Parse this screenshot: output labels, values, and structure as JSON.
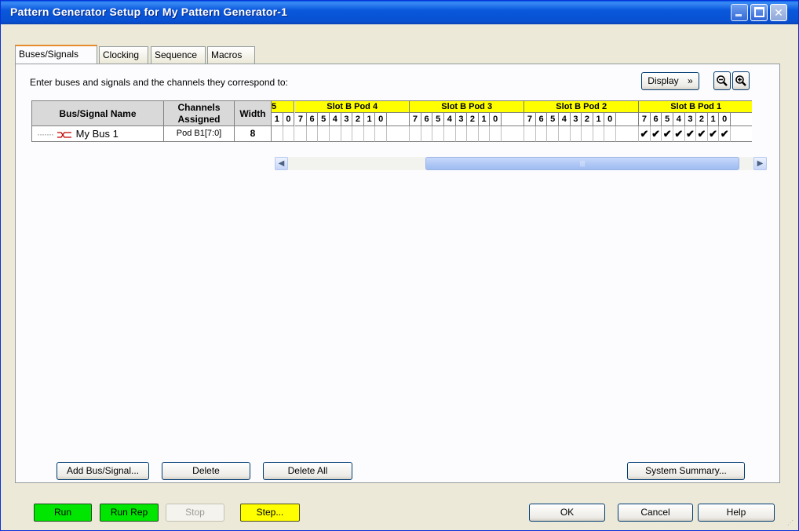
{
  "window": {
    "title": "Pattern Generator Setup for My Pattern Generator-1"
  },
  "tabs": [
    {
      "label": "Buses/Signals",
      "active": true
    },
    {
      "label": "Clocking",
      "active": false
    },
    {
      "label": "Sequence",
      "active": false
    },
    {
      "label": "Macros",
      "active": false
    }
  ],
  "instructions": "Enter buses and signals and the channels they correspond to:",
  "toolbar": {
    "display_label": "Display",
    "display_chevron": "»",
    "zoom_out_icon": "zoom-out-icon",
    "zoom_in_icon": "zoom-in-icon"
  },
  "grid": {
    "headers": {
      "name": "Bus/Signal Name",
      "channels": "Channels Assigned",
      "width": "Width"
    },
    "partial_pod_label": "5",
    "pods": [
      {
        "label": "Slot B Pod 4",
        "bits": [
          "7",
          "6",
          "5",
          "4",
          "3",
          "2",
          "1",
          "0"
        ],
        "checks": [
          false,
          false,
          false,
          false,
          false,
          false,
          false,
          false
        ]
      },
      {
        "label": "Slot B Pod 3",
        "bits": [
          "7",
          "6",
          "5",
          "4",
          "3",
          "2",
          "1",
          "0"
        ],
        "checks": [
          false,
          false,
          false,
          false,
          false,
          false,
          false,
          false
        ]
      },
      {
        "label": "Slot B Pod 2",
        "bits": [
          "7",
          "6",
          "5",
          "4",
          "3",
          "2",
          "1",
          "0"
        ],
        "checks": [
          false,
          false,
          false,
          false,
          false,
          false,
          false,
          false
        ]
      },
      {
        "label": "Slot B Pod 1",
        "bits": [
          "7",
          "6",
          "5",
          "4",
          "3",
          "2",
          "1",
          "0"
        ],
        "checks": [
          true,
          true,
          true,
          true,
          true,
          true,
          true,
          true
        ]
      }
    ],
    "partial_bits": [
      "1",
      "0"
    ],
    "rows": [
      {
        "name": "My Bus 1",
        "channels": "Pod B1[7:0]",
        "width": "8"
      }
    ],
    "check_glyph": "✔"
  },
  "buttons": {
    "add": "Add Bus/Signal...",
    "delete": "Delete",
    "delete_all": "Delete All",
    "system_summary": "System Summary...",
    "run": "Run",
    "run_rep": "Run Rep",
    "stop": "Stop",
    "step": "Step...",
    "ok": "OK",
    "cancel": "Cancel",
    "help": "Help"
  },
  "colors": {
    "pod_header": "#ffff00",
    "run": "#00e600",
    "step": "#ffff00",
    "title_bar": "#0a58dd",
    "tab_highlight": "#e68b2c"
  }
}
